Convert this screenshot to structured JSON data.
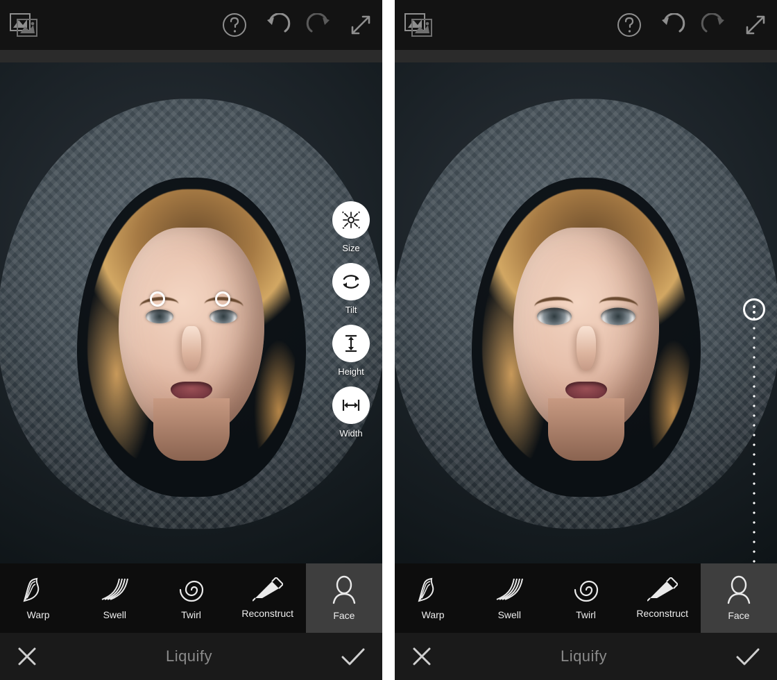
{
  "footer_title": "Liquify",
  "face_popover": [
    {
      "id": "size",
      "label": "Size"
    },
    {
      "id": "tilt",
      "label": "Tilt"
    },
    {
      "id": "height",
      "label": "Height"
    },
    {
      "id": "width",
      "label": "Width"
    }
  ],
  "tools": [
    {
      "id": "warp",
      "label": "Warp",
      "selected": false
    },
    {
      "id": "swell",
      "label": "Swell",
      "selected": false
    },
    {
      "id": "twirl",
      "label": "Twirl",
      "selected": false
    },
    {
      "id": "reconstruct",
      "label": "Reconstruct",
      "selected": false
    },
    {
      "id": "face",
      "label": "Face",
      "selected": true
    }
  ],
  "topbar_icons": [
    "image-compare-icon",
    "help-icon",
    "undo-icon",
    "redo-icon",
    "fullscreen-icon"
  ],
  "left_screen": {
    "show_face_popover": true,
    "show_eye_rings": true,
    "show_vslider": false
  },
  "right_screen": {
    "show_face_popover": false,
    "show_eye_rings": false,
    "show_vslider": true
  }
}
